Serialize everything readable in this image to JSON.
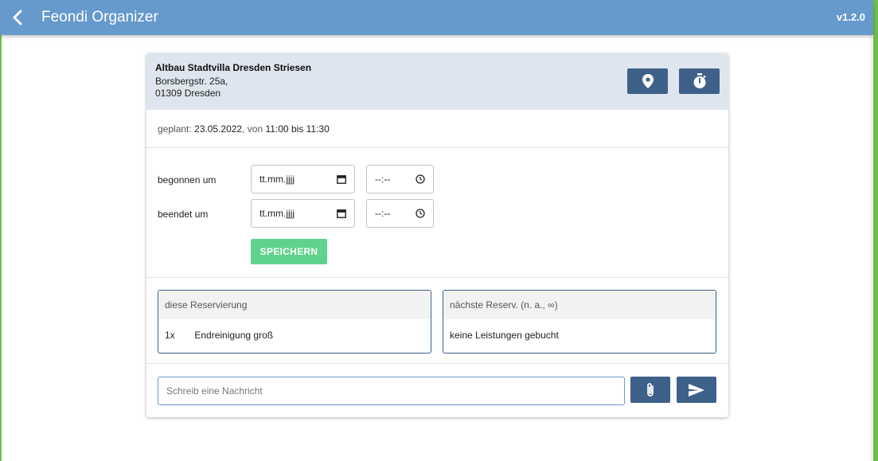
{
  "app": {
    "title": "Feondi Organizer",
    "version": "v1.2.0",
    "back_icon": "chevron-left-icon"
  },
  "property": {
    "name": "Altbau Stadtvilla Dresden Striesen",
    "street": "Borsbergstr. 25a,",
    "city": "01309 Dresden",
    "location_icon": "map-pin-icon",
    "timer_icon": "stopwatch-icon"
  },
  "planned": {
    "label": "geplant:",
    "date": "23.05.2022",
    "from_word": ", von",
    "start": "11:00",
    "to_word": "bis",
    "end": "11:30"
  },
  "times": {
    "started_label": "begonnen um",
    "ended_label": "beendet um",
    "date_placeholder": "tt.mm.jjjj",
    "time_placeholder": "--:--",
    "save_label": "SPEICHERN"
  },
  "reservations": {
    "current": {
      "title": "diese Reservierung",
      "items": [
        {
          "qty": "1x",
          "name": "Endreinigung groß"
        }
      ]
    },
    "next": {
      "title": "nächste Reserv. (n. a., ∞)",
      "empty_text": "keine Leistungen gebucht"
    }
  },
  "message": {
    "placeholder": "Schreib eine Nachricht",
    "attach_icon": "paperclip-icon",
    "send_icon": "send-icon"
  },
  "colors": {
    "topbar": "#6699cc",
    "button_dark": "#3e6189",
    "save_green": "#5fd38d",
    "card_header": "#dee5ee"
  }
}
